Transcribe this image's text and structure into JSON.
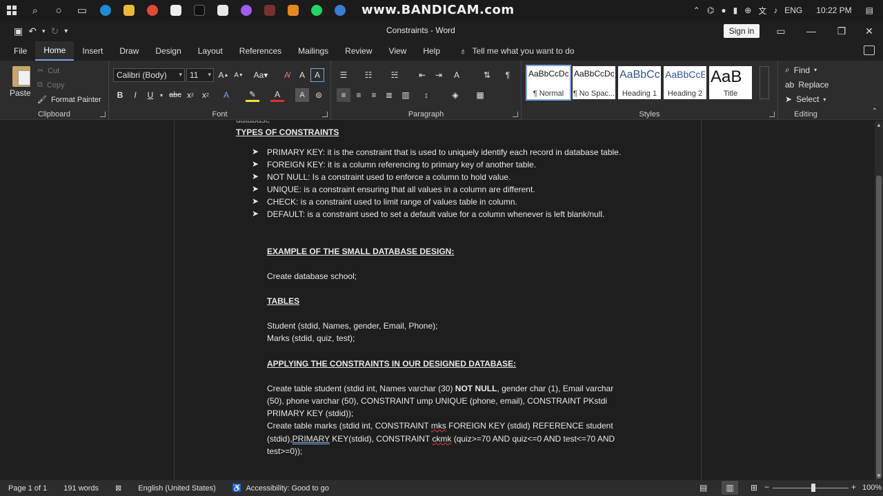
{
  "taskbar": {
    "watermark": "www.BANDICAM.com",
    "language": "ENG",
    "time": "10:22 PM"
  },
  "titlebar": {
    "doc_title": "Constraints  -  Word",
    "signin": "Sign in"
  },
  "menu": {
    "tabs": [
      "File",
      "Home",
      "Insert",
      "Draw",
      "Design",
      "Layout",
      "References",
      "Mailings",
      "Review",
      "View",
      "Help"
    ],
    "active": "Home",
    "tell_me": "Tell me what you want to do"
  },
  "ribbon": {
    "clipboard": {
      "label": "Clipboard",
      "paste": "Paste",
      "cut": "Cut",
      "copy": "Copy",
      "format_painter": "Format Painter"
    },
    "font": {
      "label": "Font",
      "font_name": "Calibri (Body)",
      "font_size": "11"
    },
    "paragraph": {
      "label": "Paragraph"
    },
    "styles": {
      "label": "Styles",
      "items": [
        {
          "sample": "AaBbCcDc",
          "name": "¶ Normal"
        },
        {
          "sample": "AaBbCcDc",
          "name": "¶ No Spac..."
        },
        {
          "sample": "AaBbCc",
          "name": "Heading 1"
        },
        {
          "sample": "AaBbCcE",
          "name": "Heading 2"
        },
        {
          "sample": "AaB",
          "name": "Title"
        }
      ]
    },
    "editing": {
      "label": "Editing",
      "find": "Find",
      "replace": "Replace",
      "select": "Select"
    }
  },
  "document": {
    "cut_line": "database",
    "heading1": "TYPES OF CONSTRAINTS",
    "bullets": [
      "PRIMARY KEY: it is the constraint that is used to uniquely identify each record in database table.",
      "FOREIGN KEY: it is a column referencing to primary key of another table.",
      "NOT NULL: Is a constraint used to enforce a column to hold value.",
      "UNIQUE: is a constraint ensuring that all values in a column are different.",
      "CHECK: is a constraint used to limit range of values table in column.",
      "DEFAULT: is a constraint used to set a default value for a column whenever is left blank/null."
    ],
    "heading2": "EXAMPLE OF THE SMALL DATABASE DESIGN:",
    "create_db": "Create database school;",
    "heading3": "TABLES",
    "table1": "Student (stdid, Names, gender, Email, Phone);",
    "table2": "Marks (stdid, quiz, test);",
    "heading4": "APPLYING THE CONSTRAINTS IN OUR DESIGNED DATABASE:",
    "sql1_a": "Create table student (stdid int, Names varchar (30) ",
    "sql1_b": "NOT NULL",
    "sql1_c": ", gender char (1), Email varchar",
    "sql2": "(50), phone varchar (50), CONSTRAINT ump UNIQUE (phone, email), CONSTRAINT PKstdi",
    "sql3": "PRIMARY KEY (stdid));",
    "sql4_a": " Create table marks (stdid int, CONSTRAINT ",
    "sql4_b": "mks",
    "sql4_c": " FOREIGN KEY (stdid) REFERENCE student",
    "sql5_a": "(stdid)",
    "sql5_b": ",PRIMARY",
    "sql5_c": " KEY(stdid), CONSTRAINT ",
    "sql5_d": "ckmk",
    "sql5_e": " (quiz>=70 AND quiz<=0 AND test<=70 AND",
    "sql6": "test>=0));"
  },
  "status": {
    "page": "Page 1 of 1",
    "words": "191 words",
    "language": "English (United States)",
    "accessibility": "Accessibility: Good to go",
    "zoom": "100%"
  }
}
